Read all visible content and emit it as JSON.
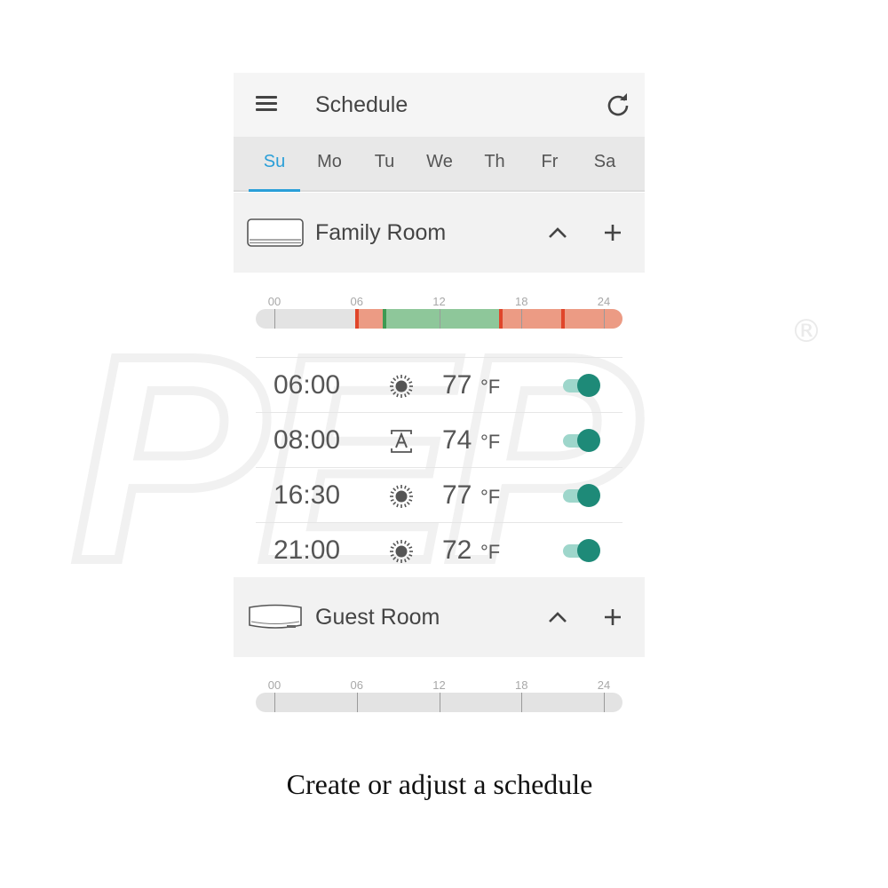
{
  "watermark": {
    "text": "PEP",
    "mark": "®"
  },
  "header": {
    "title": "Schedule",
    "menu_icon": "hamburger-icon",
    "refresh_icon": "refresh-icon"
  },
  "days": [
    {
      "label": "Su",
      "active": true
    },
    {
      "label": "Mo",
      "active": false
    },
    {
      "label": "Tu",
      "active": false
    },
    {
      "label": "We",
      "active": false
    },
    {
      "label": "Th",
      "active": false
    },
    {
      "label": "Fr",
      "active": false
    },
    {
      "label": "Sa",
      "active": false
    }
  ],
  "colors": {
    "accent": "#2a9fd8",
    "heat": "#ec9b84",
    "heat_mark": "#e0452a",
    "auto": "#8ec79a",
    "auto_mark": "#3e9a52",
    "toggle_on": "#1e8a78"
  },
  "rooms": [
    {
      "name": "Family Room",
      "timeline": {
        "labels": [
          "00",
          "06",
          "12",
          "18",
          "24"
        ],
        "segments": [
          {
            "start": 6.0,
            "end": 8.0,
            "mode": "heat"
          },
          {
            "start": 8.0,
            "end": 16.5,
            "mode": "auto"
          },
          {
            "start": 16.5,
            "end": 24.0,
            "mode": "heat"
          }
        ],
        "marks": [
          {
            "hour": 6.0,
            "mode": "heat"
          },
          {
            "hour": 8.0,
            "mode": "auto"
          },
          {
            "hour": 16.5,
            "mode": "heat"
          },
          {
            "hour": 21.0,
            "mode": "heat"
          }
        ]
      },
      "entries": [
        {
          "time": "06:00",
          "mode_icon": "sun-icon",
          "temp": "77",
          "unit": "°F",
          "enabled": true
        },
        {
          "time": "08:00",
          "mode_icon": "auto-mode-icon",
          "temp": "74",
          "unit": "°F",
          "enabled": true
        },
        {
          "time": "16:30",
          "mode_icon": "sun-icon",
          "temp": "77",
          "unit": "°F",
          "enabled": true
        },
        {
          "time": "21:00",
          "mode_icon": "sun-icon",
          "temp": "72",
          "unit": "°F",
          "enabled": true
        }
      ]
    },
    {
      "name": "Guest Room",
      "timeline": {
        "labels": [
          "00",
          "06",
          "12",
          "18",
          "24"
        ],
        "segments": [],
        "marks": []
      },
      "entries": []
    }
  ],
  "caption": "Create or adjust a schedule"
}
